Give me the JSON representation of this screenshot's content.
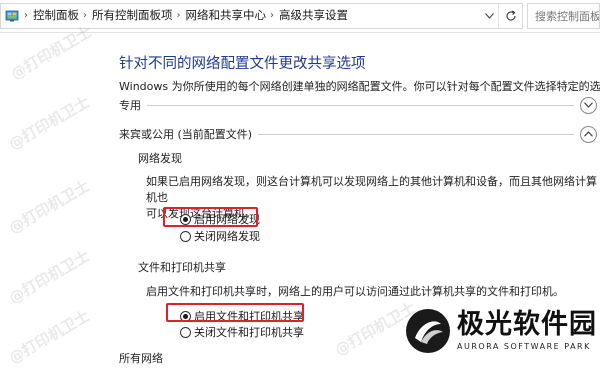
{
  "breadcrumb": {
    "items": [
      "控制面板",
      "所有控制面板项",
      "网络和共享中心",
      "高级共享设置"
    ]
  },
  "search": {
    "placeholder": "搜索控制面板"
  },
  "page": {
    "title": "针对不同的网络配置文件更改共享选项",
    "description": "Windows 为你所使用的每个网络创建单独的网络配置文件。你可以针对每个配置文件选择特定的选项。"
  },
  "sections": {
    "private": {
      "label": "专用",
      "state": "collapsed"
    },
    "guest": {
      "label": "来宾或公用 (当前配置文件)",
      "state": "expanded"
    },
    "all": {
      "label": "所有网络"
    }
  },
  "network_discovery": {
    "heading": "网络发现",
    "paragraph_line1": "如果已启用网络发现，则这台计算机可以发现网络上的其他计算机和设备，而且其他网络计算机也",
    "paragraph_line2": "可以发现这台计算机。",
    "options": [
      {
        "label": "启用网络发现",
        "checked": true
      },
      {
        "label": "关闭网络发现",
        "checked": false
      }
    ]
  },
  "file_printer_sharing": {
    "heading": "文件和打印机共享",
    "paragraph": "启用文件和打印机共享时，网络上的用户可以访问通过此计算机共享的文件和打印机。",
    "options": [
      {
        "label": "启用文件和打印机共享",
        "checked": true
      },
      {
        "label": "关闭文件和打印机共享",
        "checked": false
      }
    ]
  },
  "watermark": {
    "text": "@打印机卫士"
  },
  "logo": {
    "name_cn": "极光软件园",
    "name_en": "AURORA SOFTWARE PARK"
  },
  "colors": {
    "title_blue": "#1f3a93",
    "highlight_red": "#e0202b"
  },
  "icons": {
    "breadcrumb_root": "control-panel-icon",
    "dropdown": "chevron-down-icon",
    "refresh": "refresh-icon",
    "private_toggle": "chevron-down-circle-icon",
    "guest_toggle": "chevron-up-circle-icon"
  }
}
